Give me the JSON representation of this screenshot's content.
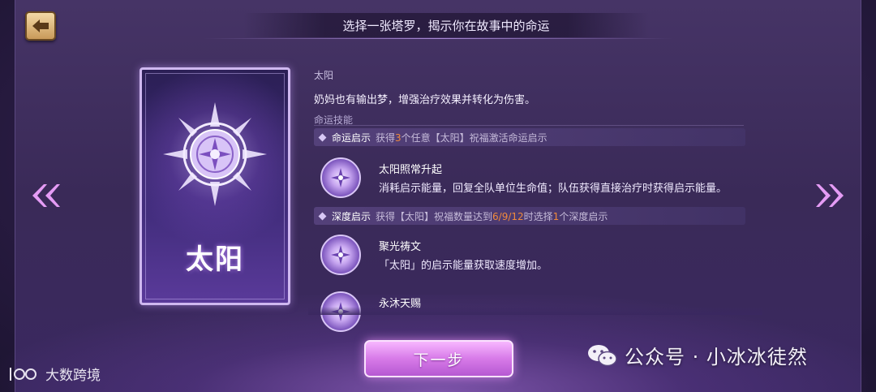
{
  "header": {
    "title": "选择一张塔罗，揭示你在故事中的命运"
  },
  "card": {
    "name": "太阳",
    "icon": "sun-icon"
  },
  "info": {
    "card_name": "太阳",
    "description": "奶妈也有输出梦，增强治疗效果并转化为伤害。",
    "skills_label": "命运技能"
  },
  "rows": {
    "fate": {
      "name": "命运启示",
      "desc_prefix": "获得",
      "count": "3",
      "desc_suffix": "个任意【太阳】祝福激活命运启示"
    },
    "deep": {
      "name": "深度启示",
      "desc_prefix": "获得【太阳】祝福数量达到",
      "thresholds": "6/9/12",
      "desc_mid": "时选择",
      "count": "1",
      "desc_suffix": "个深度启示"
    }
  },
  "skills": [
    {
      "name": "太阳照常升起",
      "desc": "消耗启示能量，回复全队单位生命值；队伍获得直接治疗时获得启示能量。"
    },
    {
      "name": "聚光祷文",
      "desc": "「太阳」的启示能量获取速度增加。"
    },
    {
      "name": "永沐天赐",
      "desc": ""
    }
  ],
  "buttons": {
    "next": "下一步"
  },
  "watermarks": {
    "right": "公众号 · 小冰冰徒然",
    "left": "大数跨境"
  },
  "colors": {
    "highlight": "#f08a3c",
    "button": "#d77ae8",
    "card_border": "#cfb8f0"
  }
}
